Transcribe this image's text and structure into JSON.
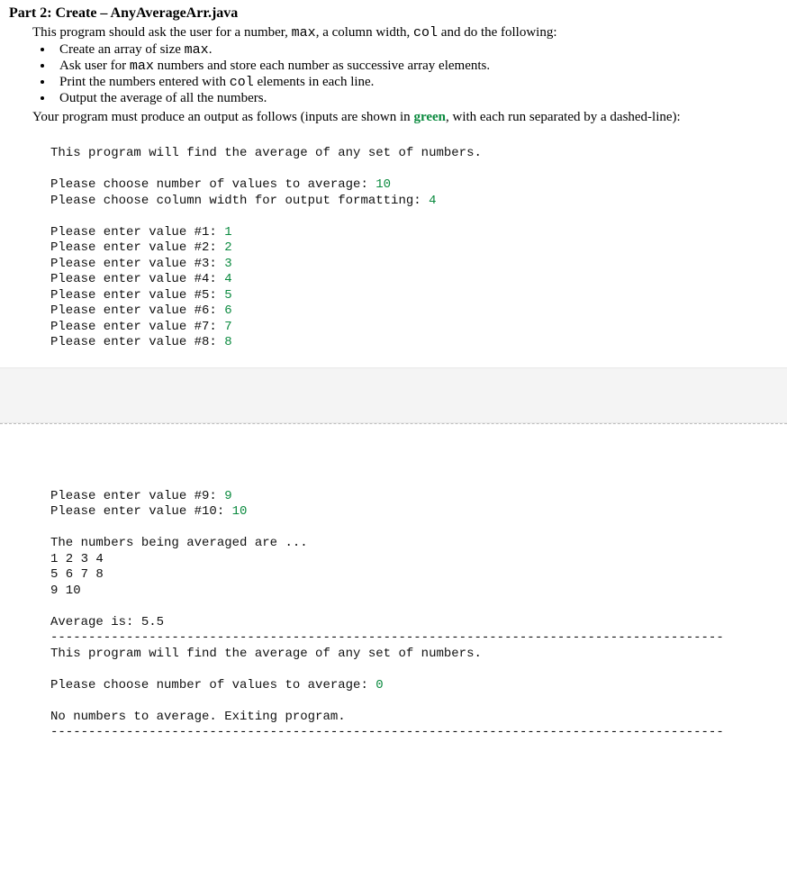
{
  "heading": "Part 2: Create – AnyAverageArr.java",
  "intro_before_max": "This program should ask the user for a number, ",
  "intro_max": "max",
  "intro_mid": ", a column width, ",
  "intro_col": "col",
  "intro_after": " and do the following:",
  "bullets": {
    "b1_pre": "Create an array of size ",
    "b1_mono": "max",
    "b1_post": ".",
    "b2_pre": "Ask user for ",
    "b2_mono": "max",
    "b2_post": " numbers and store each number as successive array elements.",
    "b3_pre": "Print the numbers entered with ",
    "b3_mono": "col",
    "b3_post": " elements in each line.",
    "b4": "Output the average of all the numbers."
  },
  "outro_pre": "Your program must produce an output as follows (inputs are shown in ",
  "outro_green": "green",
  "outro_post": ", with each run separated by a dashed-line):",
  "run1": {
    "intro": "This program will find the average of any set of numbers.",
    "prompt_count": "Please choose number of values to average: ",
    "count_val": "10",
    "prompt_col": "Please choose column width for output formatting: ",
    "col_val": "4",
    "p1": "Please enter value #1: ",
    "v1": "1",
    "p2": "Please enter value #2: ",
    "v2": "2",
    "p3": "Please enter value #3: ",
    "v3": "3",
    "p4": "Please enter value #4: ",
    "v4": "4",
    "p5": "Please enter value #5: ",
    "v5": "5",
    "p6": "Please enter value #6: ",
    "v6": "6",
    "p7": "Please enter value #7: ",
    "v7": "7",
    "p8": "Please enter value #8: ",
    "v8": "8",
    "p9": "Please enter value #9: ",
    "v9": "9",
    "p10": "Please enter value #10: ",
    "v10": "10",
    "numbers_header": "The numbers being averaged are ...",
    "row1": "1 2 3 4",
    "row2": "5 6 7 8",
    "row3": "9 10",
    "average_line": "Average is: 5.5",
    "dashes": "-----------------------------------------------------------------------------------------"
  },
  "run2": {
    "intro": "This program will find the average of any set of numbers.",
    "prompt_count": "Please choose number of values to average: ",
    "count_val": "0",
    "exit_msg": "No numbers to average. Exiting program.",
    "dashes": "-----------------------------------------------------------------------------------------"
  }
}
